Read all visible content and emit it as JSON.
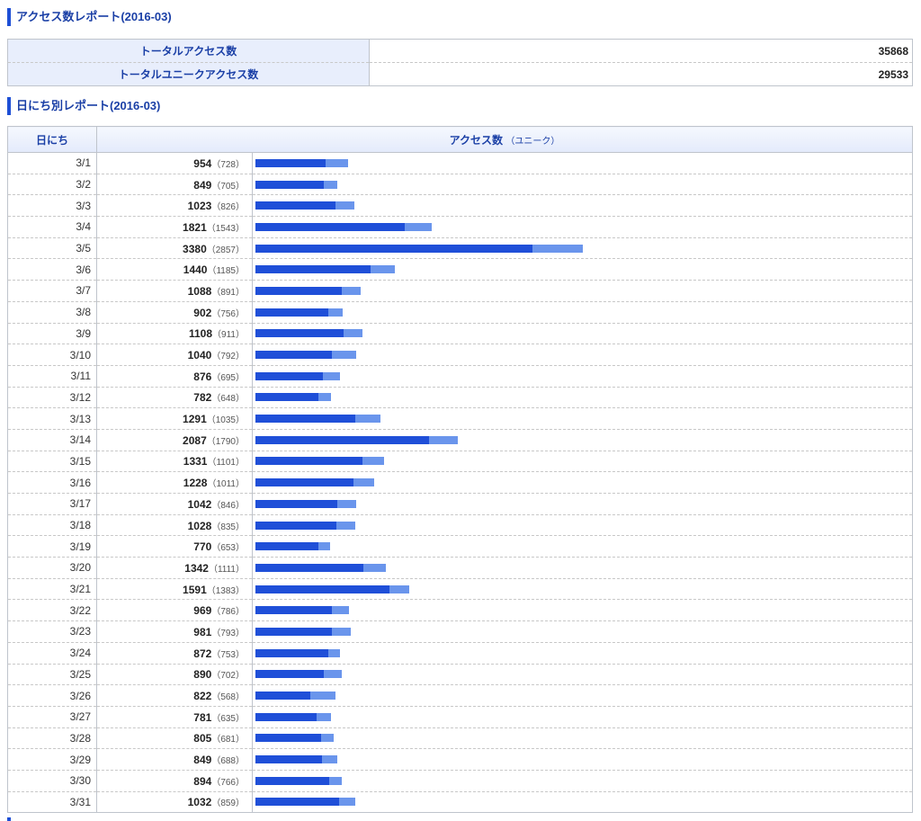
{
  "report_title": "アクセス数レポート(2016-03)",
  "summary": [
    {
      "label": "トータルアクセス数",
      "value": "35868"
    },
    {
      "label": "トータルユニークアクセス数",
      "value": "29533"
    }
  ],
  "daily_title": "日にち別レポート(2016-03)",
  "daily_header": {
    "day": "日にち",
    "access": "アクセス数",
    "unique_note": "（ユニーク）"
  },
  "colors": {
    "accent": "#1e4fd6",
    "bar_unique": "#1f4fd8",
    "bar_total": "#6a95ec",
    "header_bg": "#e8eefc"
  },
  "chart_data": {
    "type": "bar",
    "categories": [
      "3/1",
      "3/2",
      "3/3",
      "3/4",
      "3/5",
      "3/6",
      "3/7",
      "3/8",
      "3/9",
      "3/10",
      "3/11",
      "3/12",
      "3/13",
      "3/14",
      "3/15",
      "3/16",
      "3/17",
      "3/18",
      "3/19",
      "3/20",
      "3/21",
      "3/22",
      "3/23",
      "3/24",
      "3/25",
      "3/26",
      "3/27",
      "3/28",
      "3/29",
      "3/30",
      "3/31"
    ],
    "series": [
      {
        "values": [
          954,
          849,
          1023,
          1821,
          3380,
          1440,
          1088,
          902,
          1108,
          1040,
          876,
          782,
          1291,
          2087,
          1331,
          1228,
          1042,
          1028,
          770,
          1342,
          1591,
          969,
          981,
          872,
          890,
          822,
          781,
          805,
          849,
          894,
          1032
        ]
      },
      {
        "values": [
          728,
          705,
          826,
          1543,
          2857,
          1185,
          891,
          756,
          911,
          792,
          695,
          648,
          1035,
          1790,
          1101,
          1011,
          846,
          835,
          653,
          1111,
          1383,
          786,
          793,
          753,
          702,
          568,
          635,
          681,
          688,
          766,
          859
        ]
      }
    ],
    "max": 3380
  }
}
